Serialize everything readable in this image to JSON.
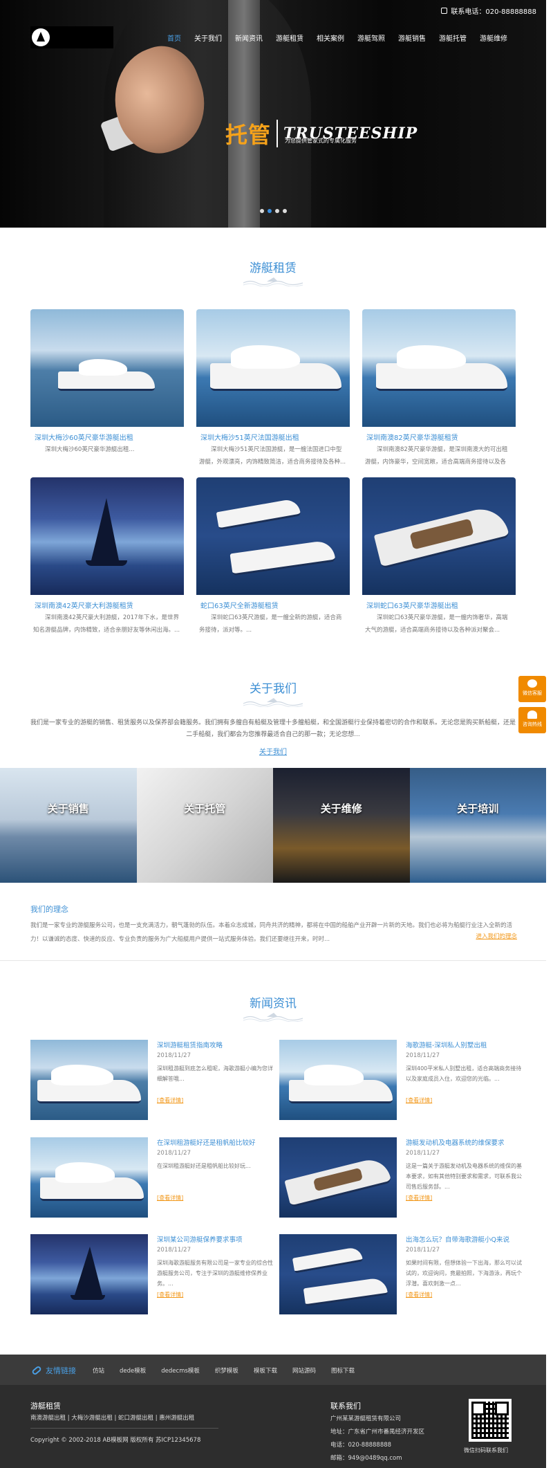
{
  "header": {
    "phone_label": "联系电话：020-88888888",
    "nav": [
      "首页",
      "关于我们",
      "新闻资讯",
      "游艇租赁",
      "相关案例",
      "游艇驾照",
      "游艇销售",
      "游艇托管",
      "游艇维修"
    ]
  },
  "banner": {
    "title_cn": "托管",
    "title_en": "TRUSTEESHIP",
    "subtitle": "为您提供管家式的专属化服务",
    "slide_count": 4,
    "active_slide": 2
  },
  "rental": {
    "title": "游艇租赁",
    "items": [
      {
        "title": "深圳大梅沙60英尺豪华游艇出租",
        "desc": "深圳大梅沙60英尺豪华游艇出租..."
      },
      {
        "title": "深圳大梅沙51英尺法国游艇出租",
        "desc": "深圳大梅沙51英尺法国游艇，是一艘法国进口中型游艇，外观漂亮，内饰精致简洁，适合商务接待及各种..."
      },
      {
        "title": "深圳南澳82英尺豪华游艇租赁",
        "desc": "深圳南澳82英尺豪华游艇，是深圳南澳大的可出租游艇，内饰豪华，空间宽敞，适合高端商务接待以及各种..."
      },
      {
        "title": "深圳南澳42英尺豪大利游艇租赁",
        "desc": "深圳南澳42英尺豪大利游艇，2017年下水，是世界知名游艇品牌，内饰精致，适合亲朋好友等休闲出海。..."
      },
      {
        "title": "蛇口63英尺全新游艇租赁",
        "desc": "深圳蛇口63英尺游艇，是一艘全新的游艇，适合商务接待，派对等。..."
      },
      {
        "title": "深圳蛇口63英尺豪华游艇出租",
        "desc": "深圳蛇口63英尺豪华游艇，是一艘内饰奢华，高端大气的游艇，适合高端商务接待以及各种派对聚会..."
      }
    ]
  },
  "about": {
    "title": "关于我们",
    "text": "我们是一家专业的游艇的销售、租赁服务以及保养部会籍服务。我们拥有多艘自有船艇及管理十多艘船艇，和全国游艇行业保持着密切的合作和联系。无论您是购买新船艇，还是二手船艇，我们都会为您推荐最适合自己的那一款；无论您想...",
    "link": "关于我们",
    "tiles": [
      "关于销售",
      "关于托管",
      "关于维修",
      "关于培训"
    ],
    "idea_title": "我们的理念",
    "idea_text": "我们是一家专业的游艇服务公司，也是一支充满活力，朝气蓬勃的队伍。本着众志成城，同舟共济的精神，都将在中国的船舶产业开辟一片新的天地。我们也必将为船艇行业注入全新的活力！以谦诚的态度、快速的反应、专业负责的服务为广大船艇用户提供一站式服务体验。我们还要继往开来，时时...",
    "idea_more": "进入我们的理念"
  },
  "news": {
    "title": "新闻资讯",
    "more_label": "[查看详情]",
    "items": [
      {
        "title": "深圳游艇租赁指南攻略",
        "date": "2018/11/27",
        "desc": "深圳租游艇到底怎么租呢，海歌游艇小编为您详细解答哦..."
      },
      {
        "title": "海歌游艇-深圳私人别墅出租",
        "date": "2018/11/27",
        "desc": "深圳400平米私人别墅出租，适合高端商务接待以及家庭成员入住，欢迎您的光临。..."
      },
      {
        "title": "在深圳租游艇好还是租帆船比较好",
        "date": "2018/11/27",
        "desc": "在深圳租游艇好还是租帆船比较好玩..."
      },
      {
        "title": "游艇发动机及电器系统的维保要求",
        "date": "2018/11/27",
        "desc": "这是一篇关于游艇发动机及电器系统的维保的基本要求，如有其他特别要求和需求，可联系我公司售后服务部。..."
      },
      {
        "title": "深圳某公司游艇保养要求事项",
        "date": "2018/11/27",
        "desc": "深圳海歌游艇服务有限公司是一家专业的综合性游艇服务公司，专注于深圳的游艇维修保养业务。..."
      },
      {
        "title": "出海怎么玩？自带海歌游艇小Q来说",
        "date": "2018/11/27",
        "desc": "如果时间有限，但想体验一下出海，那么可以试试的，欢迎询问，竟最拍照，下海游泳，再玩个浮潜。喜欢刺激一点..."
      }
    ]
  },
  "side": {
    "wechat": "微信客服",
    "bell": "咨询热线"
  },
  "links": {
    "heading": "友情链接",
    "items": [
      "仿站",
      "dede模板",
      "dedecms模板",
      "织梦模板",
      "模板下载",
      "网站源码",
      "图标下载"
    ]
  },
  "footer": {
    "col1_title": "游艇租赁",
    "col1_links": "南澳游艇出租  |  大梅沙游艇出租  |  蛇口游艇出租  |  惠州游艇出租",
    "copyright": "Copyright © 2002-2018 AB模板网 版权所有 苏ICP12345678",
    "contact_title": "联系我们",
    "company": "广州某某游艇租赁有限公司",
    "address": "地址：广东省广州市番禺经济开发区",
    "tel": "电话：020-88888888",
    "email": "邮箱：949@0489qq.com",
    "qr_caption": "微信扫码联系我们"
  },
  "colors": {
    "accent": "#3d8fd4",
    "orange": "#f29718",
    "hero_title": "#f6a21a",
    "footer": "#2d2d2d"
  }
}
